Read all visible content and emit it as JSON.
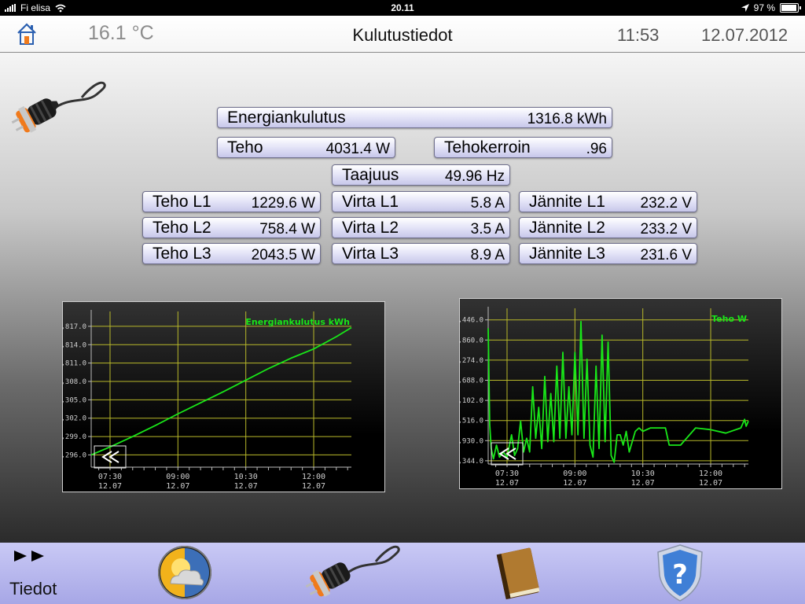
{
  "status": {
    "carrier": "Fi elisa",
    "time": "20.11",
    "battery": "97 %",
    "battery_level": 0.97
  },
  "header": {
    "temperature": "16.1 °C",
    "title": "Kulutustiedot",
    "clock": "11:53",
    "date": "12.07.2012"
  },
  "energy": {
    "label": "Energiankulutus",
    "value": "1316.8 kWh"
  },
  "power": {
    "label": "Teho",
    "value": "4031.4 W"
  },
  "power_factor": {
    "label": "Tehokerroin",
    "value": ".96"
  },
  "frequency": {
    "label": "Taajuus",
    "value": "49.96 Hz"
  },
  "phases": [
    {
      "power_label": "Teho L1",
      "power_value": "1229.6 W",
      "current_label": "Virta L1",
      "current_value": "5.8 A",
      "voltage_label": "Jännite L1",
      "voltage_value": "232.2 V"
    },
    {
      "power_label": "Teho L2",
      "power_value": "758.4 W",
      "current_label": "Virta L2",
      "current_value": "3.5 A",
      "voltage_label": "Jännite L2",
      "voltage_value": "233.2 V"
    },
    {
      "power_label": "Teho L3",
      "power_value": "2043.5 W",
      "current_label": "Virta L3",
      "current_value": "8.9 A",
      "voltage_label": "Jännite L3",
      "voltage_value": "231.6 V"
    }
  ],
  "colors": {
    "line": "#19e619",
    "grid": "#b8b82a",
    "field_border": "#6f6f8d"
  },
  "toolbar": {
    "label": "Tiedot",
    "icons": [
      "play-forward-icon",
      "weather-icon",
      "plug-icon",
      "book-icon",
      "help-shield-icon"
    ]
  },
  "chart_data": [
    {
      "type": "line",
      "title": "Energiankulutus kWh",
      "x_ticks": [
        "07:30\n12.07",
        "09:00\n12.07",
        "10:30\n12.07",
        "12:00\n12.07"
      ],
      "xlim": [
        "07:05",
        "12:50"
      ],
      "ylim": [
        1294.0,
        1318.4
      ],
      "yticks": [
        "1,296.0",
        "1,299.0",
        "1,302.0",
        "1,305.0",
        "1,308.0",
        "1,811.0",
        "1,814.0",
        "1,817.0"
      ],
      "ytick_values": [
        1296,
        1299,
        1302,
        1305,
        1308,
        1311,
        1314,
        1317
      ],
      "grid": true,
      "legend": "top-right",
      "series": [
        {
          "x": [
            "07:05",
            "07:30",
            "08:00",
            "08:30",
            "09:00",
            "09:30",
            "10:00",
            "10:30",
            "11:00",
            "11:30",
            "12:00",
            "12:30",
            "12:50"
          ],
          "y": [
            1296.0,
            1297.3,
            1299.0,
            1300.8,
            1302.7,
            1304.5,
            1306.3,
            1308.2,
            1310.1,
            1311.8,
            1313.3,
            1315.3,
            1316.8
          ]
        }
      ]
    },
    {
      "type": "line",
      "title": "Teho W",
      "x_ticks": [
        "07:30\n12.07",
        "09:00\n12.07",
        "10:30\n12.07",
        "12:00\n12.07"
      ],
      "xlim": [
        "07:05",
        "12:50"
      ],
      "ylim": [
        2750,
        7100
      ],
      "yticks": [
        "2,344.0",
        "2,930.0",
        "3,516.0",
        "4,102.0",
        "4,688.0",
        "5,274.0",
        "5,860.0",
        "6,446.0"
      ],
      "ytick_values": [
        2844,
        3430,
        4016,
        4602,
        5188,
        5774,
        6360,
        6946
      ],
      "grid": true,
      "legend": "top-right",
      "series": [
        {
          "x": [
            "07:05",
            "07:07",
            "07:09",
            "07:12",
            "07:16",
            "07:20",
            "07:25",
            "07:30",
            "07:36",
            "07:40",
            "07:44",
            "07:48",
            "07:52",
            "07:56",
            "08:00",
            "08:04",
            "08:08",
            "08:12",
            "08:16",
            "08:20",
            "08:24",
            "08:28",
            "08:32",
            "08:36",
            "08:40",
            "08:44",
            "08:48",
            "08:52",
            "08:56",
            "09:00",
            "09:04",
            "09:08",
            "09:12",
            "09:16",
            "09:20",
            "09:24",
            "09:28",
            "09:32",
            "09:36",
            "09:40",
            "09:44",
            "09:48",
            "09:52",
            "09:56",
            "10:00",
            "10:04",
            "10:08",
            "10:12",
            "10:20",
            "10:25",
            "10:30",
            "10:40",
            "11:00",
            "11:05",
            "11:20",
            "11:40",
            "12:00",
            "12:20",
            "12:40",
            "12:45",
            "12:47",
            "12:50"
          ],
          "y": [
            6700,
            3900,
            3200,
            2900,
            3300,
            2950,
            3100,
            2950,
            3600,
            3000,
            3200,
            4000,
            3100,
            3500,
            3100,
            5000,
            3500,
            4400,
            3200,
            5300,
            3400,
            4800,
            3400,
            5600,
            3500,
            6000,
            3500,
            5000,
            3600,
            6000,
            3600,
            6900,
            3500,
            5800,
            3300,
            2950,
            5600,
            3200,
            6500,
            3400,
            6300,
            3000,
            2800,
            3600,
            3600,
            3300,
            3700,
            3100,
            3700,
            3800,
            3700,
            3800,
            3800,
            3300,
            3300,
            3800,
            3750,
            3650,
            3800,
            4050,
            3850,
            4000
          ]
        }
      ]
    }
  ]
}
